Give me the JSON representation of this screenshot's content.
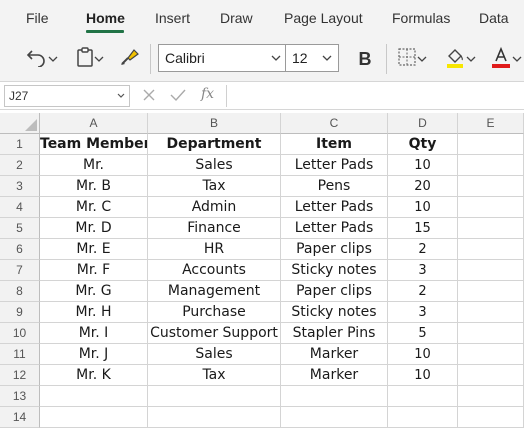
{
  "ribbon": {
    "tabs": [
      {
        "label": "File"
      },
      {
        "label": "Home",
        "active": true
      },
      {
        "label": "Insert"
      },
      {
        "label": "Draw"
      },
      {
        "label": "Page Layout"
      },
      {
        "label": "Formulas"
      },
      {
        "label": "Data"
      }
    ],
    "accent_color": "#217346"
  },
  "toolbar": {
    "undo_icon": "undo-icon",
    "paste_icon": "clipboard-icon",
    "format_painter_icon": "paintbrush-icon",
    "font_name": "Calibri",
    "font_size": "12",
    "bold_label": "B",
    "borders_icon": "borders-icon",
    "fill_color_icon": "fill-bucket-icon",
    "fill_color": "#f7e600",
    "font_color_icon": "font-color-icon",
    "font_color": "#e01b1b"
  },
  "formula_bar": {
    "cell_ref": "J27",
    "cancel_icon": "close-icon",
    "enter_icon": "check-icon",
    "fx_label": "fx",
    "formula": ""
  },
  "sheet": {
    "columns": [
      "A",
      "B",
      "C",
      "D",
      "E"
    ],
    "rows": [
      "1",
      "2",
      "3",
      "4",
      "5",
      "6",
      "7",
      "8",
      "9",
      "10",
      "11",
      "12",
      "13",
      "14"
    ],
    "headers": [
      "Team Members",
      "Department",
      "Item",
      "Qty"
    ],
    "data": [
      [
        "Mr.",
        "Sales",
        "Letter Pads",
        "10"
      ],
      [
        "Mr. B",
        "Tax",
        "Pens",
        "20"
      ],
      [
        "Mr. C",
        "Admin",
        "Letter Pads",
        "10"
      ],
      [
        "Mr. D",
        "Finance",
        "Letter Pads",
        "15"
      ],
      [
        "Mr. E",
        "HR",
        "Paper clips",
        "2"
      ],
      [
        "Mr. F",
        "Accounts",
        "Sticky notes",
        "3"
      ],
      [
        "Mr. G",
        "Management",
        "Paper clips",
        "2"
      ],
      [
        "Mr. H",
        "Purchase",
        "Sticky notes",
        "3"
      ],
      [
        "Mr. I",
        "Customer Support",
        "Stapler Pins",
        "5"
      ],
      [
        "Mr. J",
        "Sales",
        "Marker",
        "10"
      ],
      [
        "Mr. K",
        "Tax",
        "Marker",
        "10"
      ]
    ]
  }
}
